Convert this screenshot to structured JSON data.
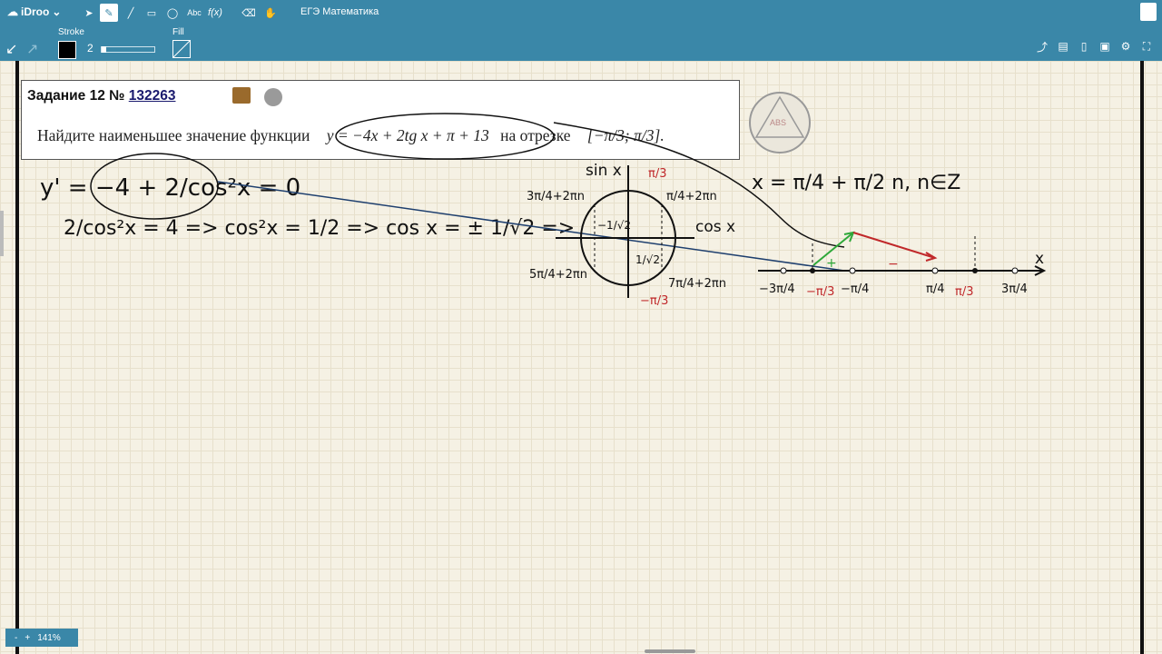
{
  "app": {
    "brand": "iDroo",
    "doc_title": "ЕГЭ Математика",
    "zoom": "141%"
  },
  "toolbar": {
    "stroke_label": "Stroke",
    "stroke_width": "2",
    "fill_label": "Fill",
    "stroke_color": "#000000",
    "tools": [
      "select",
      "pen",
      "line",
      "rectangle",
      "ellipse",
      "text",
      "formula",
      "eraser",
      "hand"
    ],
    "text_tool_label": "Abc",
    "formula_tool_label": "f(x)"
  },
  "task": {
    "title": "Задание 12 №",
    "number": "132263",
    "prompt_start": "Найдите наименьшее значение функции",
    "function": "y = −4x + 2tg x + π + 13",
    "prompt_mid": "на отрезке",
    "interval": "[−π/3; π/3]."
  },
  "stamp": {
    "label": "ABS"
  },
  "handwriting": {
    "line1": "y' = −4 + 2/cos²x = 0",
    "line2": "2/cos²x = 4 => cos²x = 1/2 => cos x = ± 1/√2 =>",
    "solution": "x = π/4 + π/2 n, n∈Z",
    "circle_labels": [
      "sin x",
      "cos x",
      "π/3",
      "−π/3",
      "3π/4+2πn",
      "π/4+2πn",
      "5π/4+2πn",
      "7π/4+2πn",
      "−1/√2",
      "1/√2"
    ],
    "axis_labels": [
      "−3π/4",
      "−π/3",
      "−π/4",
      "π/4",
      "π/3",
      "3π/4",
      "x"
    ],
    "signs": [
      "+",
      "−"
    ]
  }
}
